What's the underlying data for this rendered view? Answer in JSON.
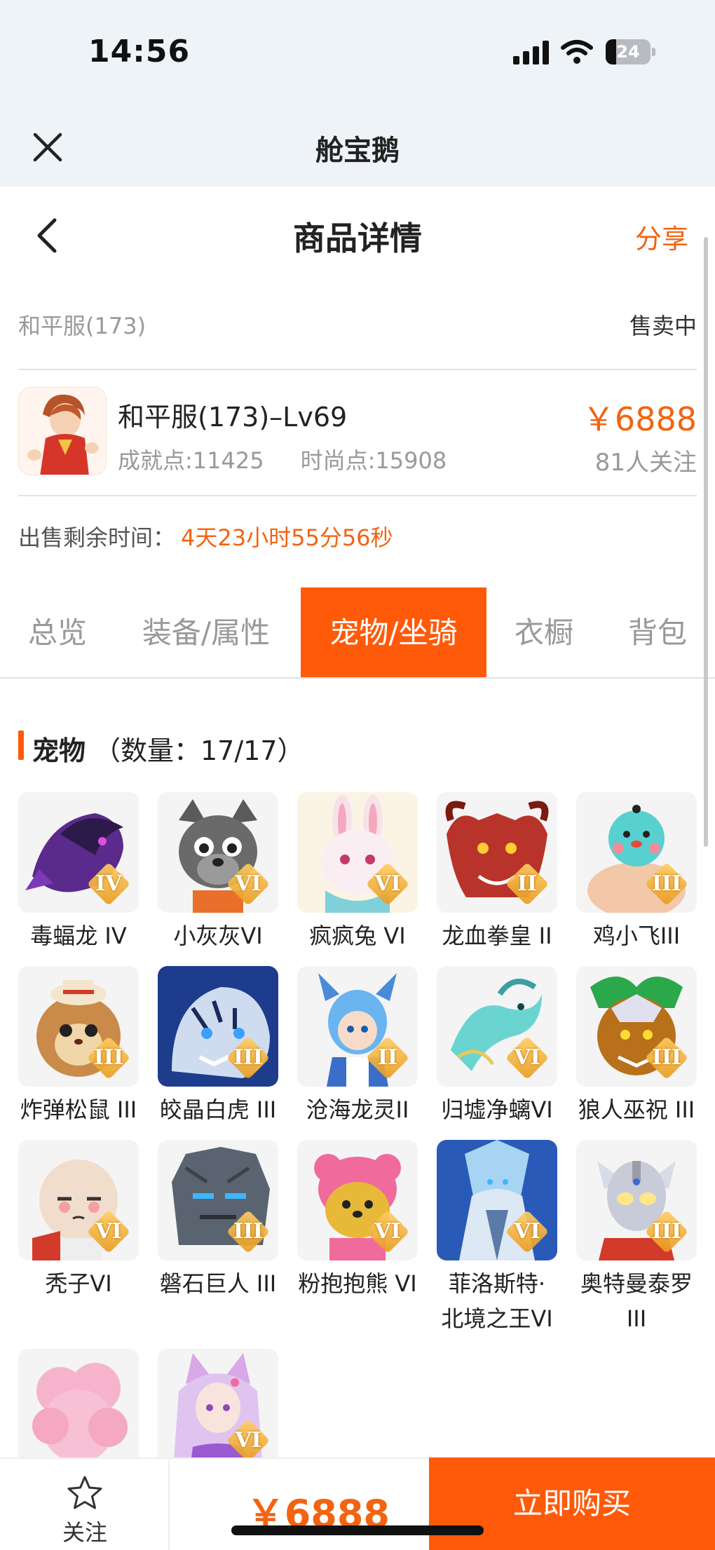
{
  "status_bar": {
    "time": "14:56",
    "battery": "24"
  },
  "mini_app": {
    "title": "舱宝鹅"
  },
  "header": {
    "title": "商品详情",
    "share": "分享"
  },
  "listing": {
    "server": "和平服(173)",
    "status": "售卖中",
    "name": "和平服(173)–Lv69",
    "achievement": "成就点:11425",
    "fashion": "时尚点:15908",
    "price": "￥6888",
    "followers": "81人关注",
    "remaining_label": "出售剩余时间：",
    "remaining_value": "4天23小时55分56秒"
  },
  "tabs": [
    {
      "label": "总览",
      "active": false
    },
    {
      "label": "装备/属性",
      "active": false
    },
    {
      "label": "宠物/坐骑",
      "active": true
    },
    {
      "label": "衣橱",
      "active": false
    },
    {
      "label": "背包",
      "active": false
    }
  ],
  "section": {
    "title": "宠物",
    "count": "（数量：17/17）"
  },
  "pets": [
    {
      "label": "毒蝠龙 IV",
      "rank": "IV",
      "icon": "purple-bat-dragon"
    },
    {
      "label": "小灰灰VI",
      "rank": "VI",
      "icon": "grey-wolf"
    },
    {
      "label": "疯疯兔 VI",
      "rank": "VI",
      "icon": "pink-rabbit"
    },
    {
      "label": "龙血拳皇 II",
      "rank": "II",
      "icon": "red-dragon-beast"
    },
    {
      "label": "鸡小飞III",
      "rank": "III",
      "icon": "blue-chick"
    },
    {
      "label": "炸弹松鼠 III",
      "rank": "III",
      "icon": "bomb-squirrel"
    },
    {
      "label": "皎晶白虎 III",
      "rank": "III",
      "icon": "white-tiger"
    },
    {
      "label": "沧海龙灵II",
      "rank": "II",
      "icon": "dragon-spirit"
    },
    {
      "label": "归墟净螭VI",
      "rank": "VI",
      "icon": "jade-dragon"
    },
    {
      "label": "狼人巫祝 III",
      "rank": "III",
      "icon": "werewolf-shaman"
    },
    {
      "label": "秃子VI",
      "rank": "VI",
      "icon": "bald-head"
    },
    {
      "label": "磐石巨人 III",
      "rank": "III",
      "icon": "rock-giant"
    },
    {
      "label": "粉抱抱熊 VI",
      "rank": "VI",
      "icon": "pink-bear"
    },
    {
      "label": "菲洛斯特·北境之王VI",
      "line1": "菲洛斯特·",
      "line2": "北境之王VI",
      "rank": "VI",
      "icon": "frost-king"
    },
    {
      "label": "奥特曼泰罗 III",
      "line1": "奥特曼泰罗",
      "line2": "III",
      "rank": "III",
      "icon": "ultraman"
    },
    {
      "label": "",
      "rank": "",
      "icon": "pink-fluff"
    },
    {
      "label": "",
      "rank": "VI",
      "icon": "fox-girl"
    }
  ],
  "bottom_bar": {
    "follow": "关注",
    "price": "￥6888",
    "buy": "立即购买"
  },
  "colors": {
    "accent": "#ff5a0a",
    "price": "#f26412"
  }
}
